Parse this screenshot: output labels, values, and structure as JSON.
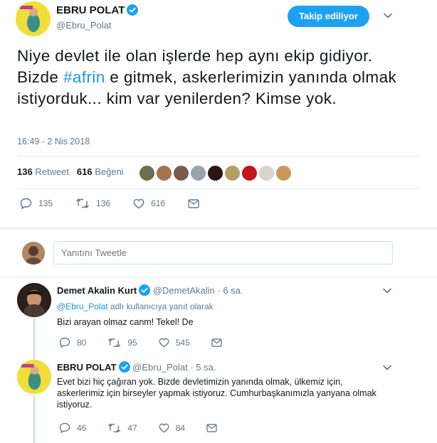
{
  "tweet": {
    "author_name": "EBRU POLAT",
    "author_handle": "@Ebru_Polat",
    "follow_label": "Takip ediliyor",
    "text_before_tag": "Niye devlet ile olan işlerde hep aynı ekip gidiyor. Bizde ",
    "hashtag": "#afrin",
    "text_after_tag": " e gitmek, askerlerimizin yanında olmak istiyorduk... kim var yenilerden? Kimse yok.",
    "timestamp": "16:49 - 2 Nis 2018",
    "retweet_count": "136",
    "retweet_label": "Retweet",
    "like_count": "616",
    "like_label": "Beğeni",
    "actions": {
      "replies": "135",
      "retweets": "136",
      "likes": "616"
    },
    "liker_colors": [
      "#6b6e4f",
      "#a5724c",
      "#7a5a4a",
      "#9aa3ab",
      "#2b1414",
      "#b39e66",
      "#c41420",
      "#d9d4cd",
      "#c89a5a"
    ]
  },
  "reply_box": {
    "placeholder": "Yanıtını Tweetle"
  },
  "replies": [
    {
      "name": "Demet Akalin Kurt",
      "handle": "@DemetAkalin",
      "time": "· 6 sa.",
      "reply_to_user": "@Ebru_Polat",
      "reply_to_suffix": " adlı kullanıcıya yanıt olarak",
      "text": "Bizi arayan olmaz canm! Tekel! De",
      "actions": {
        "replies": "80",
        "retweets": "95",
        "likes": "545"
      }
    },
    {
      "name": "EBRU POLAT",
      "handle": "@Ebru_Polat",
      "time": "· 5 sa.",
      "text": "Evet bizi hiç çağıran yok. Bizde devletimizin yanında olmak, ülkemiz için, askerlerimiz için birseyler yapmak istiyoruz. Cumhurbaşkanımızla yanyana olmak istiyoruz.",
      "actions": {
        "replies": "46",
        "retweets": "47",
        "likes": "84"
      }
    }
  ],
  "colors": {
    "accent": "#1da1f2",
    "link": "#1b95e0",
    "muted": "#657786"
  },
  "icons": [
    "verified-icon",
    "chevron-down-icon",
    "reply-icon",
    "retweet-icon",
    "heart-icon",
    "message-icon"
  ]
}
